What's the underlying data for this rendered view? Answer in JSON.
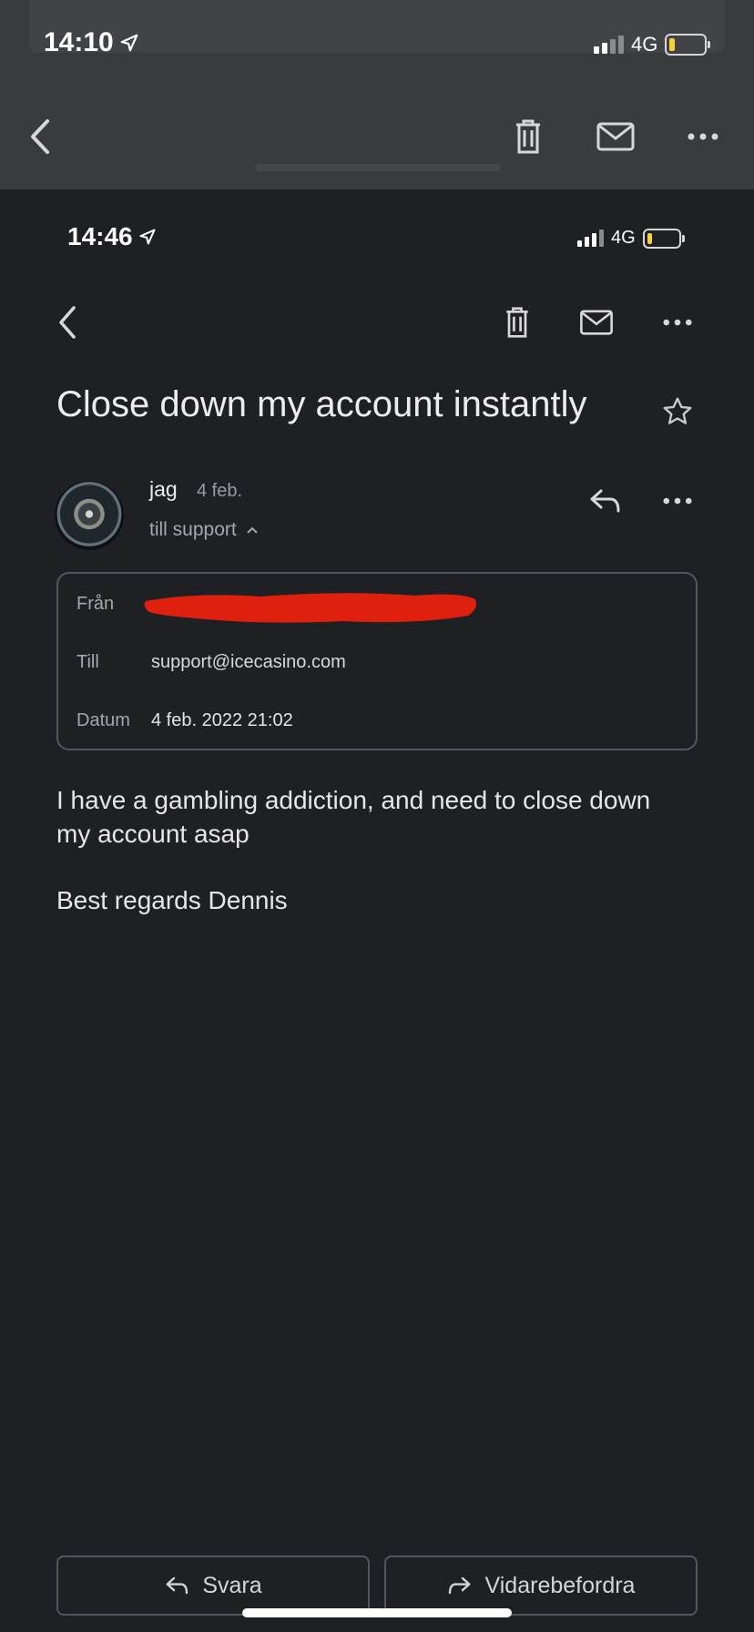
{
  "outer": {
    "status": {
      "time": "14:10",
      "network": "4G"
    }
  },
  "inner": {
    "status": {
      "time": "14:46",
      "network": "4G"
    }
  },
  "email": {
    "subject": "Close down my account instantly",
    "sender_name": "jag",
    "sender_date": "4 feb.",
    "recipient_summary": "till support",
    "details": {
      "from_label": "Från",
      "to_label": "Till",
      "to_value": "support@icecasino.com",
      "date_label": "Datum",
      "date_value": "4 feb. 2022 21:02"
    },
    "body": [
      "I have a gambling addiction, and need to close down my account asap",
      "Best regards Dennis"
    ]
  },
  "actions": {
    "reply_label": "Svara",
    "forward_label": "Vidarebefordra"
  },
  "colors": {
    "background": "#1f2024",
    "outer_header": "#3a3b3e",
    "redaction": "#e0200e",
    "battery_level": "#f5d33a"
  }
}
